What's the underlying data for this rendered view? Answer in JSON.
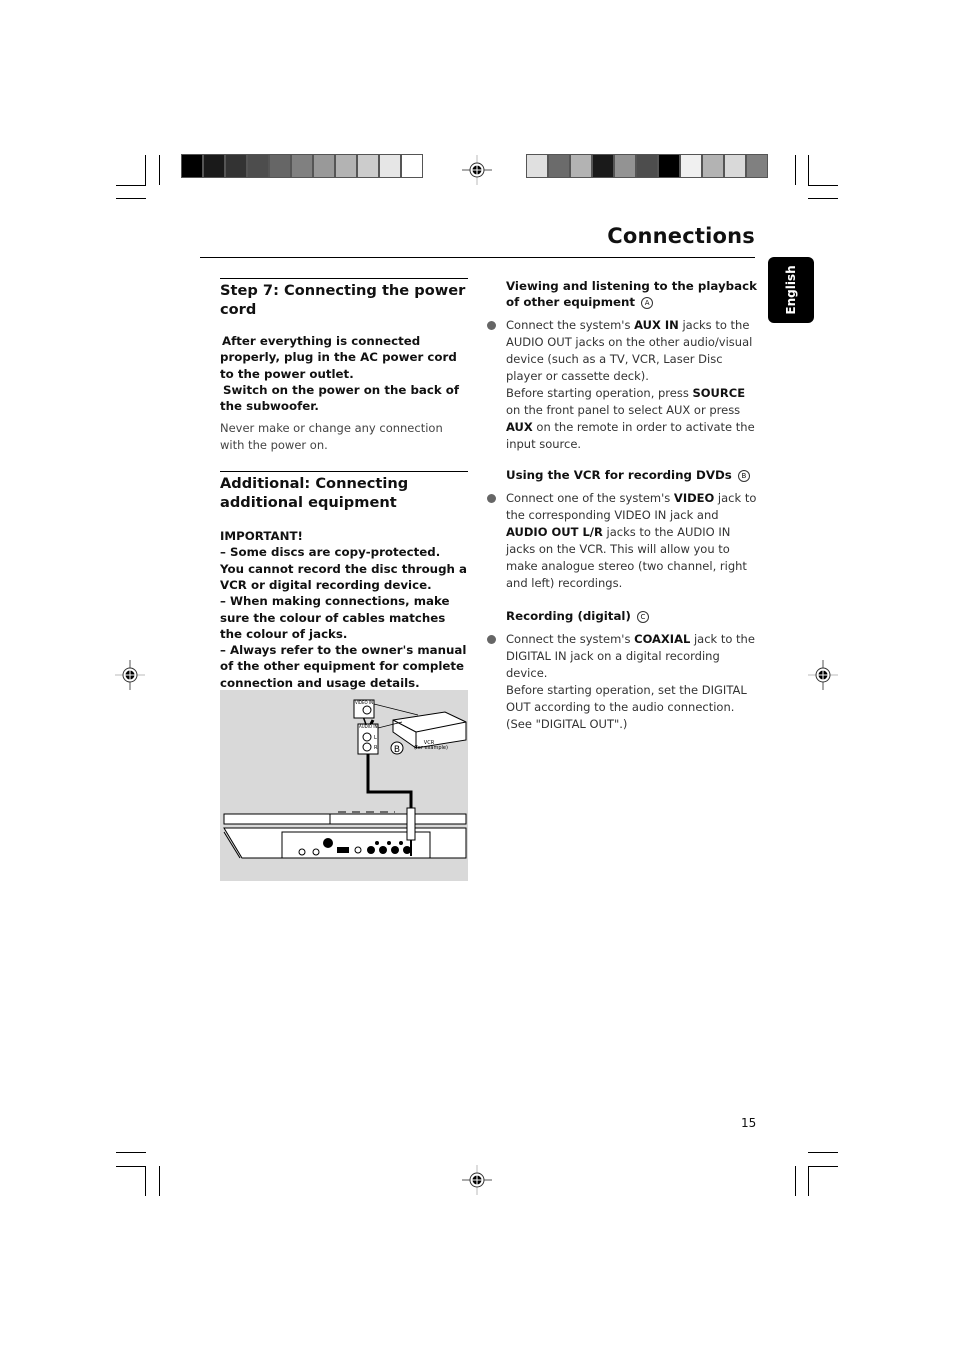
{
  "page": {
    "title": "Connections",
    "language_tab": "English",
    "page_number": "15"
  },
  "color_bars": {
    "left": [
      "#000000",
      "#1a1a1a",
      "#333333",
      "#4d4d4d",
      "#666666",
      "#808080",
      "#999999",
      "#b3b3b3",
      "#cccccc",
      "#e6e6e6",
      "#ffffff"
    ],
    "right": [
      "#e0e0e0",
      "#6b6b6b",
      "#b3b3b3",
      "#1a1a1a",
      "#939393",
      "#4d4d4d",
      "#000000",
      "#f0f0f0",
      "#b3b3b3",
      "#d9d9d9",
      "#808080"
    ]
  },
  "left_column": {
    "step7": {
      "heading": "Step 7: Connecting the power cord",
      "instructions": [
        "After everything is connected properly, plug in the AC power cord to the power outlet.",
        "Switch on the power on the back of the subwoofer."
      ],
      "note": "Never make or change any connection with the power on."
    },
    "additional": {
      "heading": "Additional: Connecting additional equipment",
      "important_label": "IMPORTANT!",
      "warnings": [
        "–  Some discs are copy-protected. You cannot record the disc through a VCR or digital recording device.",
        "–  When making connections, make sure the colour of cables matches the colour of jacks.",
        "–  Always refer to the owner's manual of the other equipment for complete connection and usage details."
      ]
    },
    "figure": {
      "labels": {
        "video_in": "VIDEO IN",
        "audio_in": "AUDIO IN",
        "left": "L",
        "right": "R",
        "marker": "B",
        "device": "VCR",
        "device_note": "(for example)"
      }
    }
  },
  "right_column": {
    "sections": [
      {
        "heading": "Viewing and listening to the playback of other equipment",
        "marker": "A",
        "bullet_parts": [
          {
            "t": "Connect the system's ",
            "b": false
          },
          {
            "t": "AUX IN",
            "b": true
          },
          {
            "t": " jacks to the AUDIO OUT jacks on the other audio/visual device (such as a TV, VCR, Laser Disc player or cassette deck).",
            "b": false
          }
        ],
        "follow_parts": [
          {
            "t": "Before starting operation, press ",
            "b": false
          },
          {
            "t": "SOURCE",
            "b": true
          },
          {
            "t": " on the front panel to select AUX or press ",
            "b": false
          },
          {
            "t": "AUX",
            "b": true
          },
          {
            "t": " on the remote in order to activate the input source.",
            "b": false
          }
        ]
      },
      {
        "heading": "Using the VCR for recording DVDs",
        "marker": "B",
        "bullet_parts": [
          {
            "t": "Connect one of the system's ",
            "b": false
          },
          {
            "t": "VIDEO",
            "b": true
          },
          {
            "t": " jack to the corresponding VIDEO IN jack and ",
            "b": false
          },
          {
            "t": "AUDIO OUT L/R",
            "b": true
          },
          {
            "t": " jacks to the AUDIO IN jacks on the VCR. This will allow you to make analogue stereo (two channel, right and left) recordings.",
            "b": false
          }
        ],
        "follow_parts": []
      },
      {
        "heading": "Recording (digital)",
        "marker": "C",
        "bullet_parts": [
          {
            "t": "Connect the system's ",
            "b": false
          },
          {
            "t": "COAXIAL",
            "b": true
          },
          {
            "t": " jack to the DIGITAL IN jack on a digital recording device.",
            "b": false
          }
        ],
        "follow_parts": [
          {
            "t": "Before starting operation, set the DIGITAL OUT according to the audio connection. (See \"DIGITAL OUT\".)",
            "b": false
          }
        ]
      }
    ]
  }
}
